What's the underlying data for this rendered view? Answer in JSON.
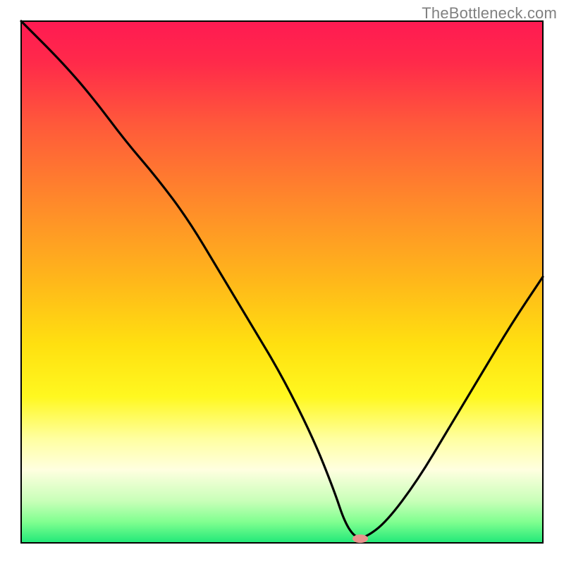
{
  "watermark": "TheBottleneck.com",
  "chart_data": {
    "type": "line",
    "title": "",
    "xlabel": "",
    "ylabel": "",
    "xlim": [
      0,
      100
    ],
    "ylim": [
      0,
      100
    ],
    "background_gradient": {
      "stops": [
        {
          "offset": 0.0,
          "color": "#ff1a52"
        },
        {
          "offset": 0.08,
          "color": "#ff2a4a"
        },
        {
          "offset": 0.2,
          "color": "#ff5a3a"
        },
        {
          "offset": 0.35,
          "color": "#ff8a2a"
        },
        {
          "offset": 0.5,
          "color": "#ffb81a"
        },
        {
          "offset": 0.62,
          "color": "#ffe010"
        },
        {
          "offset": 0.72,
          "color": "#fff820"
        },
        {
          "offset": 0.8,
          "color": "#ffffa0"
        },
        {
          "offset": 0.86,
          "color": "#ffffe0"
        },
        {
          "offset": 0.92,
          "color": "#c8ffb8"
        },
        {
          "offset": 0.96,
          "color": "#80ff90"
        },
        {
          "offset": 1.0,
          "color": "#20e878"
        }
      ]
    },
    "series": [
      {
        "name": "bottleneck-curve",
        "x": [
          0,
          8,
          14,
          20,
          26,
          32,
          38,
          44,
          50,
          56,
          60,
          62,
          64,
          66,
          70,
          76,
          82,
          88,
          94,
          100
        ],
        "y": [
          100,
          92,
          85,
          77,
          70,
          62,
          52,
          42,
          32,
          20,
          10,
          4,
          1,
          1,
          4,
          12,
          22,
          32,
          42,
          51
        ]
      }
    ],
    "marker": {
      "x": 65,
      "y": 0.8,
      "color": "#e8938d",
      "rx": 11,
      "ry": 6
    },
    "frame": {
      "stroke": "#000000",
      "width": 2
    }
  }
}
